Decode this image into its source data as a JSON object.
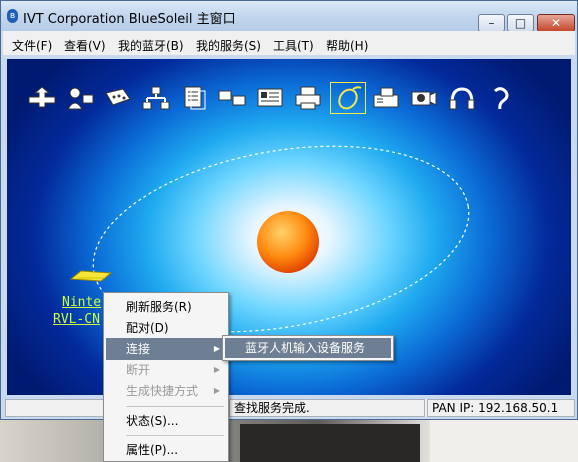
{
  "window": {
    "title": "IVT Corporation BlueSoleil 主窗口"
  },
  "menu": {
    "file": "文件(F)",
    "view": "查看(V)",
    "my_bluetooth": "我的蓝牙(B)",
    "my_services": "我的服务(S)",
    "tools": "工具(T)",
    "help": "帮助(H)"
  },
  "toolbar_icons": [
    "network-access-icon",
    "personal-area-network-icon",
    "serial-port-icon",
    "lan-access-icon",
    "file-transfer-icon",
    "sync-icon",
    "business-card-icon",
    "print-icon",
    "hid-mouse-icon",
    "fax-icon",
    "audio-gateway-icon",
    "camera-icon",
    "headset-icon",
    "headphone-icon"
  ],
  "device": {
    "name": "Ninte",
    "address": "RVL-CN"
  },
  "context_menu": {
    "refresh": "刷新服务(R)",
    "pair": "配对(D)",
    "connect": "连接",
    "disconnect": "断开",
    "shortcut": "生成快捷方式",
    "status": "状态(S)...",
    "properties": "属性(P)..."
  },
  "submenu": {
    "hid_service": "蓝牙人机输入设备服务"
  },
  "status": {
    "left": "",
    "middle": "查找服务完成.",
    "right": "PAN IP: 192.168.50.1"
  }
}
